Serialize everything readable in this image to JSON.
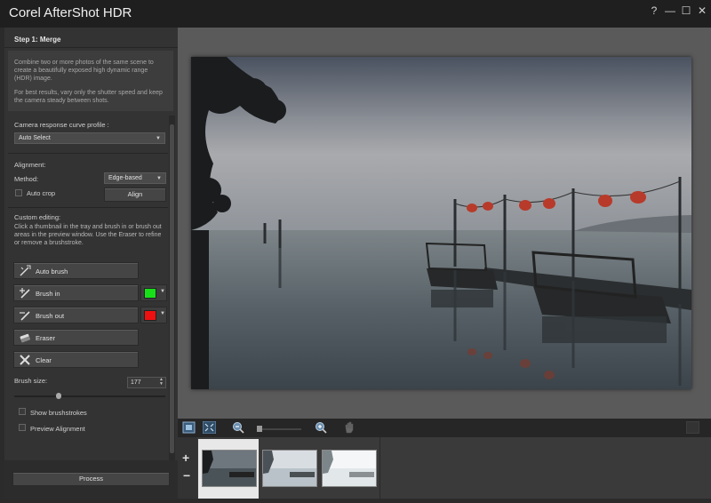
{
  "window": {
    "title": "Corel AfterShot HDR",
    "help_label": "?",
    "minimize_label": "—",
    "maximize_label": "☐",
    "close_label": "✕"
  },
  "panel": {
    "step_title": "Step 1: Merge",
    "info_line1": "Combine two or more photos of the same scene to create a beautifully exposed high dynamic range (HDR) image.",
    "info_line2": "For best results, vary only the shutter speed and keep the camera steady between shots.",
    "camera_curve_label": "Camera response curve profile :",
    "camera_curve_value": "Auto Select",
    "alignment_label": "Alignment:",
    "method_label": "Method:",
    "method_value": "Edge-based",
    "autocrop_label": "Auto crop",
    "align_button": "Align",
    "custom_editing_label": "Custom editing:",
    "custom_editing_help": "Click a thumbnail in the tray and brush in or brush out areas in the preview window. Use the Eraser to refine or remove a brushstroke.",
    "auto_brush_label": "Auto brush",
    "brush_in_label": "Brush in",
    "brush_out_label": "Brush out",
    "eraser_label": "Eraser",
    "clear_label": "Clear",
    "brush_in_color": "#18e018",
    "brush_out_color": "#ee1010",
    "brush_size_label": "Brush size:",
    "brush_size_value": "177",
    "show_brushstrokes_label": "Show brushstrokes",
    "preview_alignment_label": "Preview Alignment",
    "process_button": "Process"
  },
  "tray": {
    "add_label": "+",
    "remove_label": "−"
  },
  "icons": {
    "fit": "fit-to-window-icon",
    "actual": "actual-size-icon",
    "zoom_out": "zoom-out-icon",
    "zoom_in": "zoom-in-icon",
    "pan": "hand-pan-icon"
  }
}
